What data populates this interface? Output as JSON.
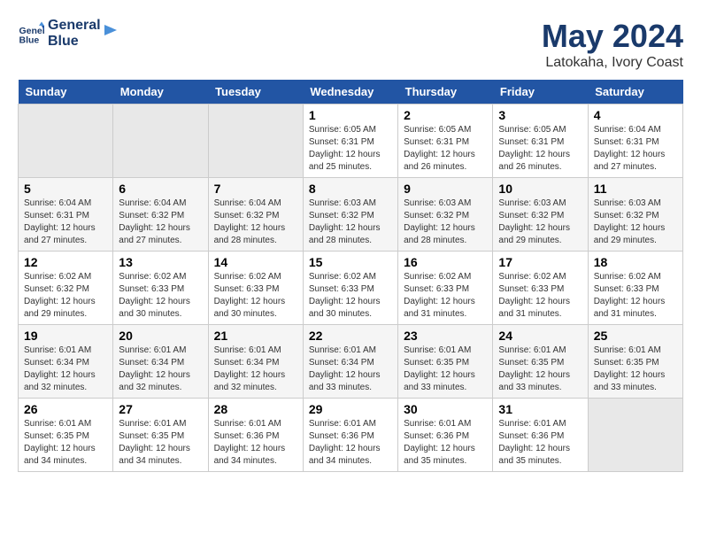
{
  "header": {
    "logo_line1": "General",
    "logo_line2": "Blue",
    "month_year": "May 2024",
    "location": "Latokaha, Ivory Coast"
  },
  "weekdays": [
    "Sunday",
    "Monday",
    "Tuesday",
    "Wednesday",
    "Thursday",
    "Friday",
    "Saturday"
  ],
  "weeks": [
    [
      {
        "day": "",
        "info": ""
      },
      {
        "day": "",
        "info": ""
      },
      {
        "day": "",
        "info": ""
      },
      {
        "day": "1",
        "info": "Sunrise: 6:05 AM\nSunset: 6:31 PM\nDaylight: 12 hours\nand 25 minutes."
      },
      {
        "day": "2",
        "info": "Sunrise: 6:05 AM\nSunset: 6:31 PM\nDaylight: 12 hours\nand 26 minutes."
      },
      {
        "day": "3",
        "info": "Sunrise: 6:05 AM\nSunset: 6:31 PM\nDaylight: 12 hours\nand 26 minutes."
      },
      {
        "day": "4",
        "info": "Sunrise: 6:04 AM\nSunset: 6:31 PM\nDaylight: 12 hours\nand 27 minutes."
      }
    ],
    [
      {
        "day": "5",
        "info": "Sunrise: 6:04 AM\nSunset: 6:31 PM\nDaylight: 12 hours\nand 27 minutes."
      },
      {
        "day": "6",
        "info": "Sunrise: 6:04 AM\nSunset: 6:32 PM\nDaylight: 12 hours\nand 27 minutes."
      },
      {
        "day": "7",
        "info": "Sunrise: 6:04 AM\nSunset: 6:32 PM\nDaylight: 12 hours\nand 28 minutes."
      },
      {
        "day": "8",
        "info": "Sunrise: 6:03 AM\nSunset: 6:32 PM\nDaylight: 12 hours\nand 28 minutes."
      },
      {
        "day": "9",
        "info": "Sunrise: 6:03 AM\nSunset: 6:32 PM\nDaylight: 12 hours\nand 28 minutes."
      },
      {
        "day": "10",
        "info": "Sunrise: 6:03 AM\nSunset: 6:32 PM\nDaylight: 12 hours\nand 29 minutes."
      },
      {
        "day": "11",
        "info": "Sunrise: 6:03 AM\nSunset: 6:32 PM\nDaylight: 12 hours\nand 29 minutes."
      }
    ],
    [
      {
        "day": "12",
        "info": "Sunrise: 6:02 AM\nSunset: 6:32 PM\nDaylight: 12 hours\nand 29 minutes."
      },
      {
        "day": "13",
        "info": "Sunrise: 6:02 AM\nSunset: 6:33 PM\nDaylight: 12 hours\nand 30 minutes."
      },
      {
        "day": "14",
        "info": "Sunrise: 6:02 AM\nSunset: 6:33 PM\nDaylight: 12 hours\nand 30 minutes."
      },
      {
        "day": "15",
        "info": "Sunrise: 6:02 AM\nSunset: 6:33 PM\nDaylight: 12 hours\nand 30 minutes."
      },
      {
        "day": "16",
        "info": "Sunrise: 6:02 AM\nSunset: 6:33 PM\nDaylight: 12 hours\nand 31 minutes."
      },
      {
        "day": "17",
        "info": "Sunrise: 6:02 AM\nSunset: 6:33 PM\nDaylight: 12 hours\nand 31 minutes."
      },
      {
        "day": "18",
        "info": "Sunrise: 6:02 AM\nSunset: 6:33 PM\nDaylight: 12 hours\nand 31 minutes."
      }
    ],
    [
      {
        "day": "19",
        "info": "Sunrise: 6:01 AM\nSunset: 6:34 PM\nDaylight: 12 hours\nand 32 minutes."
      },
      {
        "day": "20",
        "info": "Sunrise: 6:01 AM\nSunset: 6:34 PM\nDaylight: 12 hours\nand 32 minutes."
      },
      {
        "day": "21",
        "info": "Sunrise: 6:01 AM\nSunset: 6:34 PM\nDaylight: 12 hours\nand 32 minutes."
      },
      {
        "day": "22",
        "info": "Sunrise: 6:01 AM\nSunset: 6:34 PM\nDaylight: 12 hours\nand 33 minutes."
      },
      {
        "day": "23",
        "info": "Sunrise: 6:01 AM\nSunset: 6:35 PM\nDaylight: 12 hours\nand 33 minutes."
      },
      {
        "day": "24",
        "info": "Sunrise: 6:01 AM\nSunset: 6:35 PM\nDaylight: 12 hours\nand 33 minutes."
      },
      {
        "day": "25",
        "info": "Sunrise: 6:01 AM\nSunset: 6:35 PM\nDaylight: 12 hours\nand 33 minutes."
      }
    ],
    [
      {
        "day": "26",
        "info": "Sunrise: 6:01 AM\nSunset: 6:35 PM\nDaylight: 12 hours\nand 34 minutes."
      },
      {
        "day": "27",
        "info": "Sunrise: 6:01 AM\nSunset: 6:35 PM\nDaylight: 12 hours\nand 34 minutes."
      },
      {
        "day": "28",
        "info": "Sunrise: 6:01 AM\nSunset: 6:36 PM\nDaylight: 12 hours\nand 34 minutes."
      },
      {
        "day": "29",
        "info": "Sunrise: 6:01 AM\nSunset: 6:36 PM\nDaylight: 12 hours\nand 34 minutes."
      },
      {
        "day": "30",
        "info": "Sunrise: 6:01 AM\nSunset: 6:36 PM\nDaylight: 12 hours\nand 35 minutes."
      },
      {
        "day": "31",
        "info": "Sunrise: 6:01 AM\nSunset: 6:36 PM\nDaylight: 12 hours\nand 35 minutes."
      },
      {
        "day": "",
        "info": ""
      }
    ]
  ]
}
